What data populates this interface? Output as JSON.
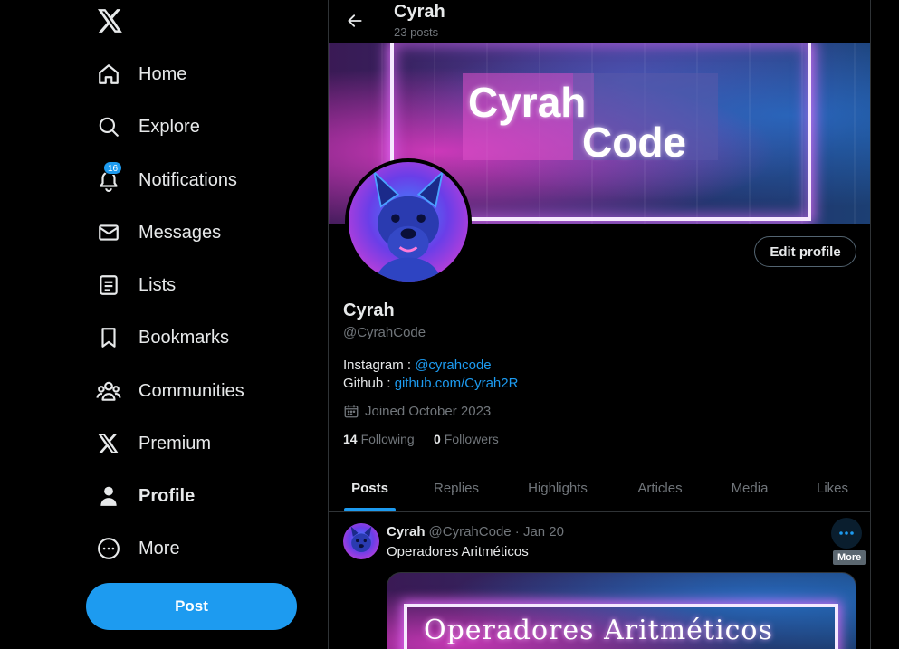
{
  "nav": {
    "logo_icon": "x-logo-icon",
    "items": [
      {
        "label": "Home",
        "icon": "home-icon"
      },
      {
        "label": "Explore",
        "icon": "search-icon"
      },
      {
        "label": "Notifications",
        "icon": "bell-icon",
        "badge": "16"
      },
      {
        "label": "Messages",
        "icon": "mail-icon"
      },
      {
        "label": "Lists",
        "icon": "lists-icon"
      },
      {
        "label": "Bookmarks",
        "icon": "bookmark-icon"
      },
      {
        "label": "Communities",
        "icon": "communities-icon"
      },
      {
        "label": "Premium",
        "icon": "x-premium-icon"
      },
      {
        "label": "Profile",
        "icon": "person-icon"
      },
      {
        "label": "More",
        "icon": "more-circle-icon"
      }
    ],
    "post_label": "Post"
  },
  "header": {
    "name": "Cyrah",
    "post_count": "23 posts"
  },
  "banner": {
    "line1": "Cyrah",
    "line2": "Code"
  },
  "profile": {
    "edit_label": "Edit profile",
    "name": "Cyrah",
    "handle": "@CyrahCode",
    "bio_line1_prefix": "Instagram : ",
    "bio_line1_link": "@cyrahcode",
    "bio_line2_prefix": "Github : ",
    "bio_line2_link": "github.com/Cyrah2R",
    "joined": "Joined October 2023",
    "following_count": "14",
    "following_label": "Following",
    "followers_count": "0",
    "followers_label": "Followers"
  },
  "tabs": [
    "Posts",
    "Replies",
    "Highlights",
    "Articles",
    "Media",
    "Likes"
  ],
  "tweet": {
    "name": "Cyrah",
    "meta": "@CyrahCode · Jan 20",
    "text": "Operadores Aritméticos",
    "more_tooltip": "More",
    "media_text": "Operadores Aritméticos"
  },
  "colors": {
    "accent": "#1d9bf0",
    "background": "#000000",
    "text": "#e7e9ea",
    "muted": "#71767b",
    "border": "#2f3336"
  }
}
